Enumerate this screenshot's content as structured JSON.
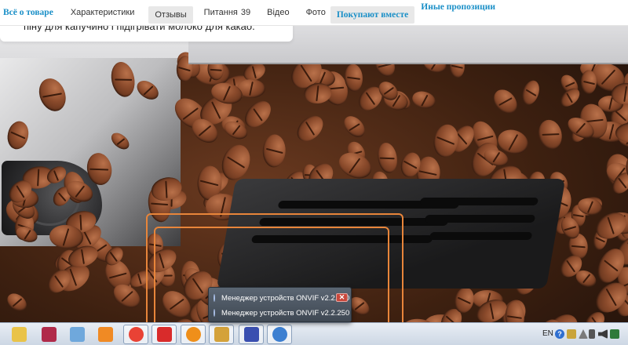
{
  "tabs": [
    {
      "label": "Всё о товаре",
      "style": "bold-blue"
    },
    {
      "label": "Характеристики",
      "style": "normal"
    },
    {
      "label": "Отзывы",
      "style": "pill"
    },
    {
      "label": "Питання",
      "count": "39",
      "style": "normal"
    },
    {
      "label": "Відео",
      "style": "normal"
    },
    {
      "label": "Фото",
      "style": "normal"
    },
    {
      "label": "Покупают вместе",
      "style": "bold-blue-pill"
    },
    {
      "label": "Иные пропозиции",
      "style": "bold-blue"
    }
  ],
  "description_snippet": "піну для капучино і підігрівати молоко для какао.",
  "popup": {
    "items": [
      {
        "label": "Менеджер устройств ONVIF v2.2.250",
        "has_close": true
      },
      {
        "label": "Менеджер устройств ONVIF v2.2.250",
        "has_close": false
      }
    ],
    "close_glyph": "✕"
  },
  "taskbar": {
    "apps": [
      {
        "icon": "file-explorer-icon",
        "color": "#e9c349",
        "active": false
      },
      {
        "icon": "winrar-icon",
        "color": "#b02a4a",
        "active": false
      },
      {
        "icon": "notepad-icon",
        "color": "#6fa8dc",
        "active": false
      },
      {
        "icon": "media-player-icon",
        "color": "#f08a24",
        "active": false
      },
      {
        "icon": "chrome-icon",
        "color": "#e94235",
        "active": true
      },
      {
        "icon": "app-red-icon",
        "color": "#d92b2b",
        "active": true
      },
      {
        "icon": "app-orange-circle-icon",
        "color": "#ef8f1a",
        "active": true
      },
      {
        "icon": "app-tools-icon",
        "color": "#d4a23a",
        "active": true
      },
      {
        "icon": "app-grid-icon",
        "color": "#3a4fb0",
        "active": true
      },
      {
        "icon": "app-refresh-icon",
        "color": "#3c7fd1",
        "active": true
      }
    ],
    "language": "EN",
    "help_glyph": "?"
  },
  "colors": {
    "accent_blue": "#1a8fc7",
    "highlight_orange": "#e8853a"
  }
}
